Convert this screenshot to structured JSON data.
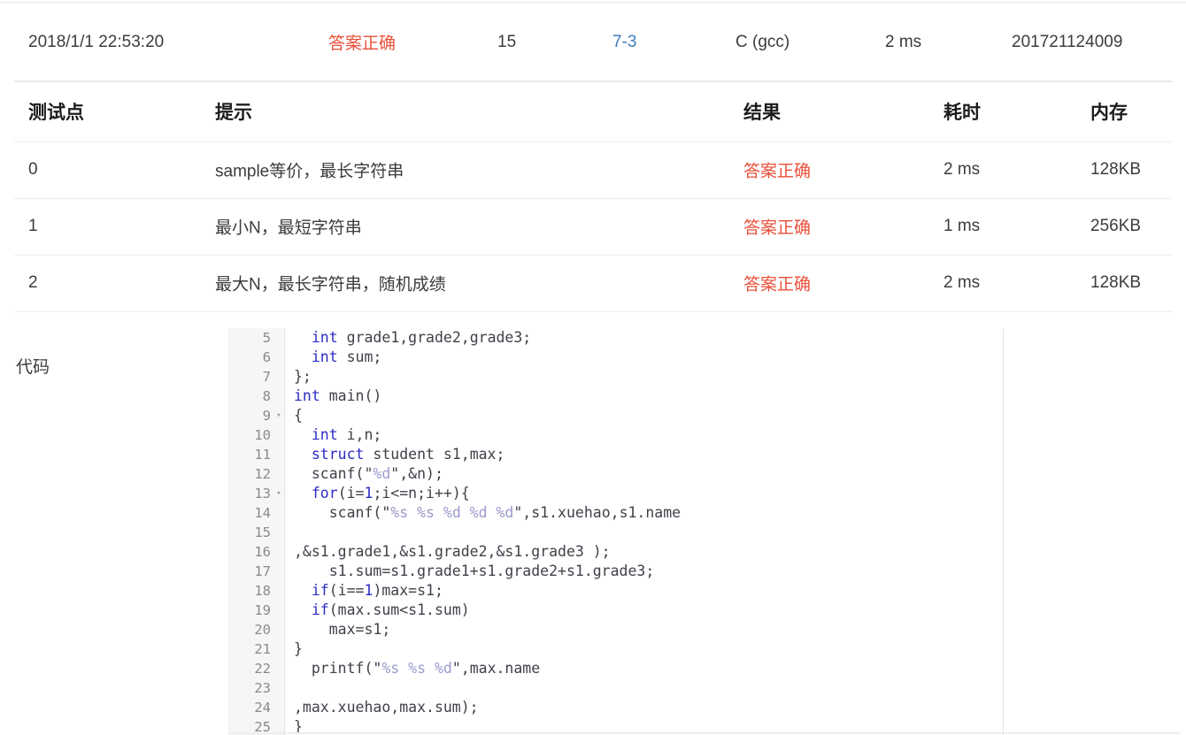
{
  "submission": {
    "time": "2018/1/1 22:53:20",
    "result": "答案正确",
    "score": "15",
    "problem": "7-3",
    "language": "C (gcc)",
    "elapsed": "2 ms",
    "user_id": "201721124009",
    "result_color": "#e8503a",
    "problem_link_color": "#3d7ebd"
  },
  "testpoints": {
    "headers": {
      "no": "测试点",
      "hint": "提示",
      "result": "结果",
      "time": "耗时",
      "memory": "内存"
    },
    "rows": [
      {
        "no": "0",
        "hint": "sample等价，最长字符串",
        "result": "答案正确",
        "time": "2 ms",
        "memory": "128KB"
      },
      {
        "no": "1",
        "hint": "最小N，最短字符串",
        "result": "答案正确",
        "time": "1 ms",
        "memory": "256KB"
      },
      {
        "no": "2",
        "hint": "最大N，最长字符串，随机成绩",
        "result": "答案正确",
        "time": "2 ms",
        "memory": "128KB"
      }
    ]
  },
  "code_section": {
    "label": "代码",
    "lines": [
      {
        "n": "5",
        "fold": "",
        "text": "  int grade1,grade2,grade3;"
      },
      {
        "n": "6",
        "fold": "",
        "text": "  int sum;"
      },
      {
        "n": "7",
        "fold": "",
        "text": "};"
      },
      {
        "n": "8",
        "fold": "",
        "text": "int main()"
      },
      {
        "n": "9",
        "fold": "▾",
        "text": "{"
      },
      {
        "n": "10",
        "fold": "",
        "text": "  int i,n;"
      },
      {
        "n": "11",
        "fold": "",
        "text": "  struct student s1,max;"
      },
      {
        "n": "12",
        "fold": "",
        "text": "  scanf(\"%d\",&n);"
      },
      {
        "n": "13",
        "fold": "▾",
        "text": "  for(i=1;i<=n;i++){"
      },
      {
        "n": "14",
        "fold": "",
        "text": "    scanf(\"%s %s %d %d %d\",s1.xuehao,s1.name"
      },
      {
        "n": "15",
        "fold": "",
        "text": ""
      },
      {
        "n": "16",
        "fold": "",
        "text": ",&s1.grade1,&s1.grade2,&s1.grade3 );"
      },
      {
        "n": "17",
        "fold": "",
        "text": "    s1.sum=s1.grade1+s1.grade2+s1.grade3;"
      },
      {
        "n": "18",
        "fold": "",
        "text": "  if(i==1)max=s1;"
      },
      {
        "n": "19",
        "fold": "",
        "text": "  if(max.sum<s1.sum)"
      },
      {
        "n": "20",
        "fold": "",
        "text": "    max=s1;"
      },
      {
        "n": "21",
        "fold": "",
        "text": "}"
      },
      {
        "n": "22",
        "fold": "",
        "text": "  printf(\"%s %s %d\",max.name"
      },
      {
        "n": "23",
        "fold": "",
        "text": ""
      },
      {
        "n": "24",
        "fold": "",
        "text": ",max.xuehao,max.sum);"
      },
      {
        "n": "25",
        "fold": "",
        "text": "}"
      }
    ]
  }
}
